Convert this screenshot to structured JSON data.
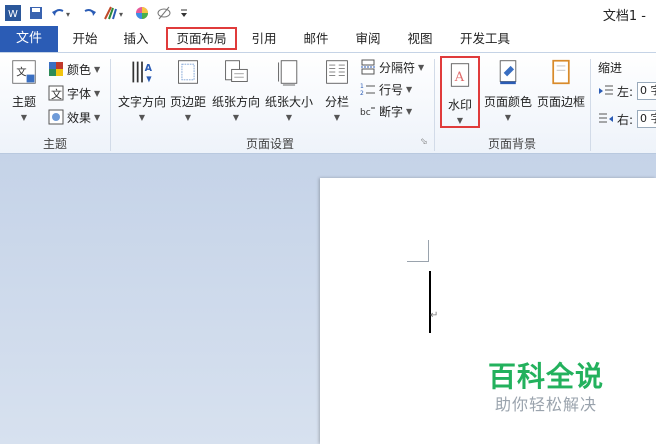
{
  "title_bar": {
    "doc_title": "文档1 -",
    "quick_access": [
      "word-logo-icon",
      "save-icon",
      "undo-icon",
      "redo-icon",
      "format-painter-icon",
      "color-wheel-icon",
      "no-edit-icon",
      "customize-icon"
    ]
  },
  "tabs": [
    {
      "id": "file",
      "label": "文件"
    },
    {
      "id": "home",
      "label": "开始"
    },
    {
      "id": "insert",
      "label": "插入"
    },
    {
      "id": "layout",
      "label": "页面布局"
    },
    {
      "id": "references",
      "label": "引用"
    },
    {
      "id": "mailings",
      "label": "邮件"
    },
    {
      "id": "review",
      "label": "审阅"
    },
    {
      "id": "view",
      "label": "视图"
    },
    {
      "id": "developer",
      "label": "开发工具"
    }
  ],
  "ribbon": {
    "themes": {
      "group_label": "主题",
      "theme_btn": "主题",
      "colors": "颜色",
      "fonts": "字体",
      "effects": "效果"
    },
    "page_setup": {
      "group_label": "页面设置",
      "text_direction": "文字方向",
      "margins": "页边距",
      "orientation": "纸张方向",
      "size": "纸张大小",
      "columns": "分栏",
      "breaks": "分隔符",
      "line_numbers": "行号",
      "hyphenation": "断字"
    },
    "page_background": {
      "group_label": "页面背景",
      "watermark": "水印",
      "page_color": "页面颜色",
      "page_borders": "页面边框"
    },
    "paragraph": {
      "indent_title": "缩进",
      "left_label": "左:",
      "right_label": "右:",
      "left_value": "0 字",
      "right_value": "0 字"
    }
  },
  "document": {
    "paragraph_mark": "↵"
  },
  "brand": {
    "main": "百科全说",
    "sub": "助你轻松解决"
  },
  "colors": {
    "accent": "#2b5cb5",
    "highlight": "#e03b3b",
    "brand_green": "#23b15d"
  }
}
